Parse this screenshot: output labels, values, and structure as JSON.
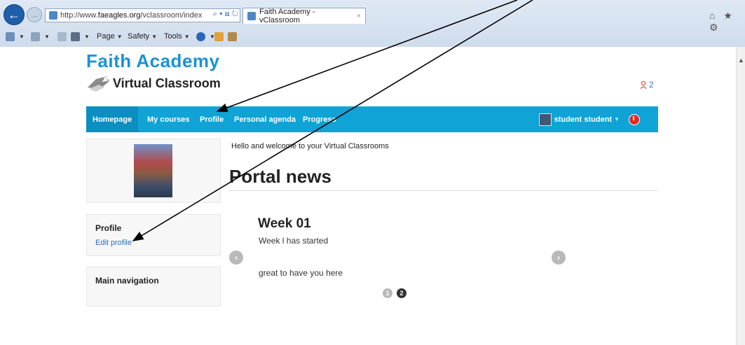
{
  "browser": {
    "url_prefix": "http://www.",
    "url_domain": "faeagles.org",
    "url_path": "/vclassroom/index",
    "address_icons": "⌕ ▾ ⊠ ↻",
    "tab_title": "Faith Academy - vClassroom",
    "tab_close": "×",
    "right_icons": "⌂ ★ ⚙"
  },
  "command_bar": {
    "page_label": "Page",
    "safety_label": "Safety",
    "tools_label": "Tools"
  },
  "site": {
    "name": "Faith Academy",
    "subtitle": "Virtual Classroom",
    "message_count": "2"
  },
  "nav": {
    "homepage": "Homepage",
    "my_courses": "My courses",
    "profile": "Profile",
    "personal_agenda": "Personal agenda",
    "progress": "Progress",
    "user_name": "student student"
  },
  "sidebar": {
    "profile_title": "Profile",
    "edit_profile": "Edit profile",
    "main_navigation": "Main navigation"
  },
  "main": {
    "welcome": "Hello and welcome to your Virtual Classrooms",
    "portal_title": "Portal news",
    "news_title": "Week 01",
    "news_line1": "Week   l has started",
    "news_line2": "great to have you here",
    "prev": "‹",
    "next": "›",
    "pages": [
      "1",
      "2"
    ]
  },
  "colors": {
    "brand_blue": "#1a93d2",
    "navbar": "#0fa3d6",
    "logout": "#e02b2b"
  }
}
